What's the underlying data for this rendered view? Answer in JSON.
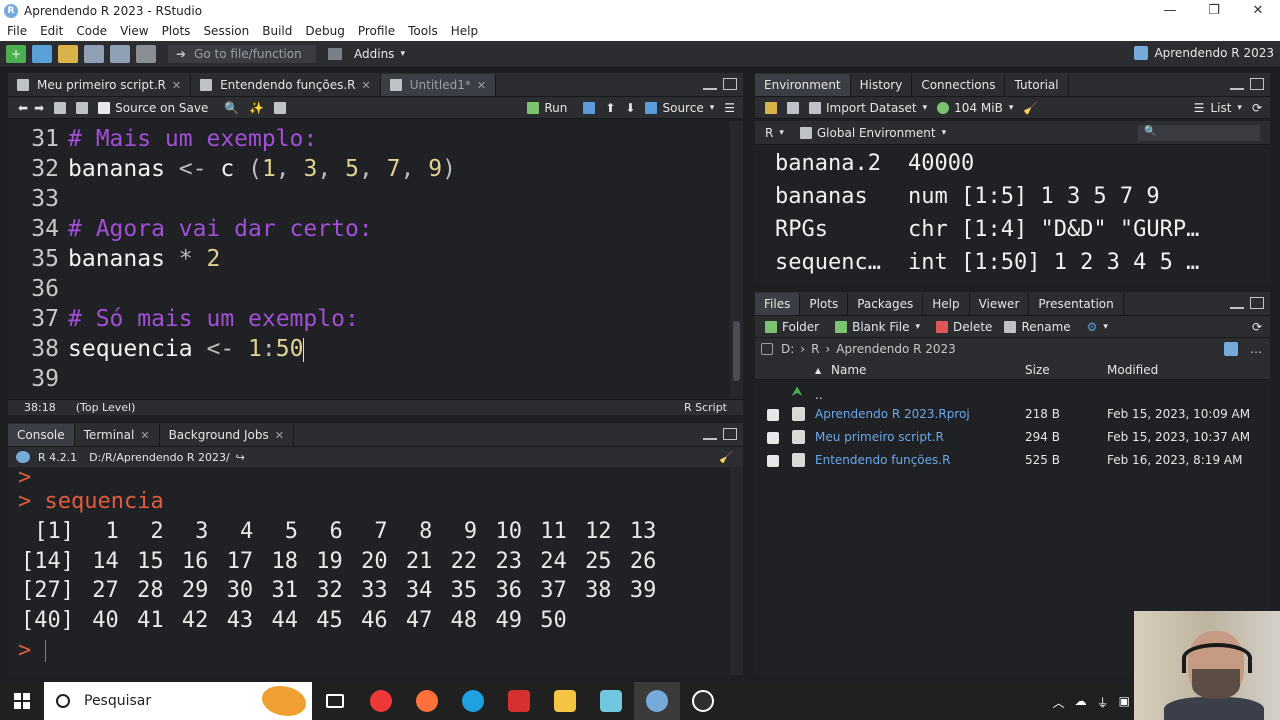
{
  "window": {
    "title": "Aprendendo R 2023 - RStudio",
    "controls": [
      "—",
      "❐",
      "✕"
    ]
  },
  "menu": [
    "File",
    "Edit",
    "Code",
    "View",
    "Plots",
    "Session",
    "Build",
    "Debug",
    "Profile",
    "Tools",
    "Help"
  ],
  "toolbar": {
    "goto_placeholder": "Go to file/function",
    "addins": "Addins",
    "project": "Aprendendo R 2023"
  },
  "editor": {
    "tabs": [
      {
        "label": "Meu primeiro script.R",
        "active": false
      },
      {
        "label": "Entendendo funções.R",
        "active": false
      },
      {
        "label": "Untitled1*",
        "active": true
      }
    ],
    "source_on_save": "Source on Save",
    "run": "Run",
    "source": "Source",
    "lines": [
      {
        "n": "31",
        "text": "# Mais um exemplo:",
        "kind": "comment"
      },
      {
        "n": "32",
        "text": "bananas <- c (1, 3, 5, 7, 9)",
        "kind": "code"
      },
      {
        "n": "33",
        "text": "",
        "kind": "blank"
      },
      {
        "n": "34",
        "text": "# Agora vai dar certo:",
        "kind": "comment"
      },
      {
        "n": "35",
        "text": "bananas * 2",
        "kind": "code"
      },
      {
        "n": "36",
        "text": "",
        "kind": "blank"
      },
      {
        "n": "37",
        "text": "# Só mais um exemplo:",
        "kind": "comment"
      },
      {
        "n": "38",
        "text": "sequencia <- 1:50",
        "kind": "code"
      },
      {
        "n": "39",
        "text": "",
        "kind": "blank"
      }
    ],
    "status": {
      "position": "38:18",
      "level": "(Top Level)",
      "filetype": "R Script"
    }
  },
  "console": {
    "tabs": [
      {
        "label": "Console",
        "active": true
      },
      {
        "label": "Terminal",
        "active": false
      },
      {
        "label": "Background Jobs",
        "active": false
      }
    ],
    "r_version": "R 4.2.1",
    "path": "D:/R/Aprendendo R 2023/",
    "first_prompt": ">",
    "command": "> sequencia",
    "output": [
      {
        "idx": "[1]",
        "values": [
          "1",
          "2",
          "3",
          "4",
          "5",
          "6",
          "7",
          "8",
          "9",
          "10",
          "11",
          "12",
          "13"
        ]
      },
      {
        "idx": "[14]",
        "values": [
          "14",
          "15",
          "16",
          "17",
          "18",
          "19",
          "20",
          "21",
          "22",
          "23",
          "24",
          "25",
          "26"
        ]
      },
      {
        "idx": "[27]",
        "values": [
          "27",
          "28",
          "29",
          "30",
          "31",
          "32",
          "33",
          "34",
          "35",
          "36",
          "37",
          "38",
          "39"
        ]
      },
      {
        "idx": "[40]",
        "values": [
          "40",
          "41",
          "42",
          "43",
          "44",
          "45",
          "46",
          "47",
          "48",
          "49",
          "50"
        ]
      }
    ],
    "prompt": ">"
  },
  "environment": {
    "tabs": [
      "Environment",
      "History",
      "Connections",
      "Tutorial"
    ],
    "import_dataset": "Import Dataset",
    "memory": "104 MiB",
    "view_mode": "List",
    "lang": "R",
    "scope": "Global Environment",
    "vars": [
      {
        "name": "banana.2",
        "value": "40000"
      },
      {
        "name": "bananas",
        "value": "num [1:5] 1 3 5 7 9"
      },
      {
        "name": "RPGs",
        "value": "chr [1:4] \"D&D\" \"GURP…"
      },
      {
        "name": "sequenc…",
        "value": "int [1:50] 1 2 3 4 5 …"
      }
    ]
  },
  "files": {
    "tabs": [
      "Files",
      "Plots",
      "Packages",
      "Help",
      "Viewer",
      "Presentation"
    ],
    "actions": [
      "Folder",
      "Blank File",
      "Delete",
      "Rename"
    ],
    "path": [
      "D:",
      "R",
      "Aprendendo R 2023"
    ],
    "columns": [
      "Name",
      "Size",
      "Modified"
    ],
    "up": "..",
    "rows": [
      {
        "name": "Aprendendo R 2023.Rproj",
        "size": "218 B",
        "modified": "Feb 15, 2023, 10:09 AM"
      },
      {
        "name": "Meu primeiro script.R",
        "size": "294 B",
        "modified": "Feb 15, 2023, 10:37 AM"
      },
      {
        "name": "Entendendo funções.R",
        "size": "525 B",
        "modified": "Feb 16, 2023, 8:19 AM"
      }
    ]
  },
  "taskbar": {
    "search": "Pesquisar"
  }
}
